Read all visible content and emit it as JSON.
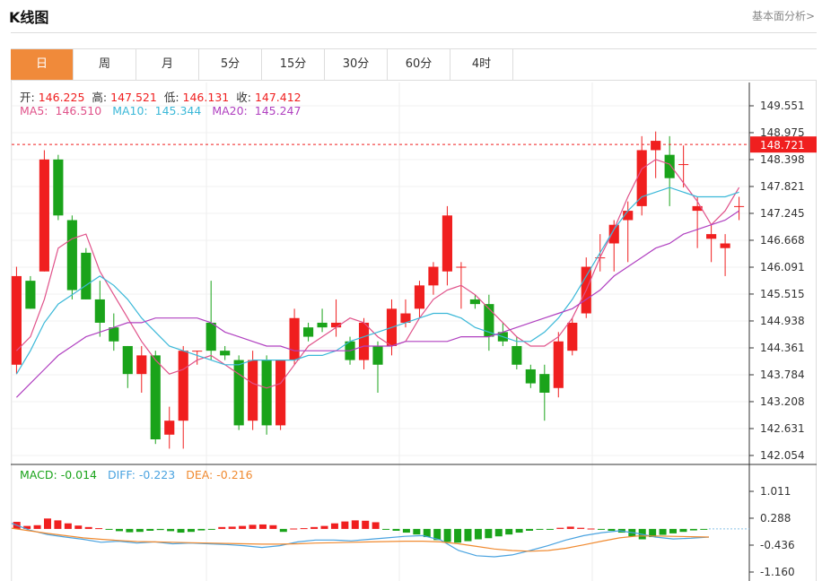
{
  "header": {
    "title": "K线图",
    "link": "基本面分析>"
  },
  "tabs": [
    {
      "label": "日",
      "active": true
    },
    {
      "label": "周"
    },
    {
      "label": "月"
    },
    {
      "label": "5分"
    },
    {
      "label": "15分"
    },
    {
      "label": "30分"
    },
    {
      "label": "60分"
    },
    {
      "label": "4时"
    }
  ],
  "ohlc_legend": {
    "open_label": "开:",
    "open": "146.225",
    "high_label": "高:",
    "high": "147.521",
    "low_label": "低:",
    "low": "146.131",
    "close_label": "收:",
    "close": "147.412"
  },
  "ma_legend": {
    "ma5_label": "MA5:",
    "ma5": "146.510",
    "ma10_label": "MA10:",
    "ma10": "145.344",
    "ma20_label": "MA20:",
    "ma20": "145.247"
  },
  "macd_legend": {
    "macd_label": "MACD:",
    "macd": "-0.014",
    "diff_label": "DIFF:",
    "diff": "-0.223",
    "dea_label": "DEA:",
    "dea": "-0.216"
  },
  "colors": {
    "up": "#f01f1f",
    "down": "#1aa31a",
    "ma5": "#e0528a",
    "ma10": "#3bb8d8",
    "ma20": "#b040c0",
    "diff": "#4aa3e0",
    "dea": "#f08a30",
    "price_tag": "#f01f1f",
    "tab_active": "#f08a3a"
  },
  "chart_data": [
    {
      "type": "candlestick",
      "current_price": "148.721",
      "ylim": [
        142.054,
        149.551
      ],
      "y_ticks": [
        "149.551",
        "148.975",
        "148.398",
        "147.821",
        "147.245",
        "146.668",
        "146.091",
        "145.515",
        "144.938",
        "144.361",
        "143.784",
        "143.208",
        "142.631",
        "142.054"
      ],
      "series": [
        {
          "name": "MA5",
          "values": [
            144.3,
            144.6,
            145.4,
            146.5,
            146.7,
            146.8,
            146.0,
            145.5,
            145.0,
            144.5,
            144.1,
            143.8,
            143.9,
            144.1,
            144.2,
            144.0,
            143.8,
            143.6,
            143.5,
            143.6,
            144.0,
            144.4,
            144.6,
            144.8,
            145.0,
            144.9,
            144.6,
            144.4,
            144.5,
            145.0,
            145.4,
            145.6,
            145.7,
            145.5,
            145.2,
            144.9,
            144.6,
            144.4,
            144.4,
            144.6,
            145.0,
            145.6,
            146.3,
            146.9,
            147.6,
            148.2,
            148.4,
            148.3,
            147.9,
            147.5,
            147.0,
            147.3,
            147.8
          ]
        },
        {
          "name": "MA10",
          "values": [
            143.8,
            144.3,
            144.9,
            145.3,
            145.5,
            145.7,
            145.9,
            145.7,
            145.4,
            145.0,
            144.7,
            144.4,
            144.3,
            144.2,
            144.1,
            144.0,
            144.0,
            144.1,
            144.1,
            144.1,
            144.1,
            144.2,
            144.2,
            144.3,
            144.5,
            144.6,
            144.7,
            144.8,
            144.9,
            145.0,
            145.1,
            145.1,
            145.0,
            144.8,
            144.7,
            144.6,
            144.5,
            144.5,
            144.7,
            145.0,
            145.4,
            145.9,
            146.4,
            146.9,
            147.3,
            147.6,
            147.7,
            147.8,
            147.7,
            147.6,
            147.6,
            147.6,
            147.7
          ]
        },
        {
          "name": "MA20",
          "values": [
            143.3,
            143.6,
            143.9,
            144.2,
            144.4,
            144.6,
            144.7,
            144.8,
            144.9,
            144.9,
            145.0,
            145.0,
            145.0,
            145.0,
            144.9,
            144.7,
            144.6,
            144.5,
            144.4,
            144.4,
            144.3,
            144.3,
            144.3,
            144.3,
            144.3,
            144.4,
            144.4,
            144.4,
            144.5,
            144.5,
            144.5,
            144.5,
            144.6,
            144.6,
            144.6,
            144.7,
            144.8,
            144.9,
            145.0,
            145.1,
            145.2,
            145.4,
            145.6,
            145.9,
            146.1,
            146.3,
            146.5,
            146.6,
            146.8,
            146.9,
            147.0,
            147.1,
            147.3
          ]
        }
      ],
      "candles": [
        [
          144.0,
          145.9,
          143.8,
          146.1
        ],
        [
          145.8,
          145.2,
          145.2,
          145.9
        ],
        [
          146.0,
          148.4,
          146.0,
          148.6
        ],
        [
          148.4,
          147.2,
          147.1,
          148.5
        ],
        [
          147.1,
          145.6,
          145.4,
          147.2
        ],
        [
          146.4,
          145.4,
          145.4,
          146.5
        ],
        [
          145.4,
          144.9,
          144.6,
          145.8
        ],
        [
          144.8,
          144.5,
          144.3,
          145.1
        ],
        [
          144.4,
          143.8,
          143.5,
          144.4
        ],
        [
          143.8,
          144.2,
          143.4,
          144.4
        ],
        [
          144.2,
          142.4,
          142.3,
          144.3
        ],
        [
          142.5,
          142.8,
          142.2,
          143.1
        ],
        [
          142.8,
          144.3,
          142.2,
          144.4
        ],
        [
          144.3,
          144.3,
          144.0,
          144.3
        ],
        [
          144.9,
          144.3,
          144.1,
          145.8
        ],
        [
          144.3,
          144.2,
          144.1,
          144.4
        ],
        [
          144.1,
          142.7,
          142.6,
          144.2
        ],
        [
          142.8,
          144.1,
          142.6,
          144.3
        ],
        [
          144.1,
          142.7,
          142.5,
          144.2
        ],
        [
          142.7,
          144.1,
          142.6,
          144.1
        ],
        [
          144.1,
          145.0,
          144.0,
          145.2
        ],
        [
          144.8,
          144.6,
          144.5,
          144.9
        ],
        [
          144.9,
          144.8,
          144.7,
          145.2
        ],
        [
          144.8,
          144.9,
          144.6,
          145.4
        ],
        [
          144.5,
          144.1,
          144.0,
          144.6
        ],
        [
          144.1,
          144.9,
          143.9,
          145.0
        ],
        [
          144.4,
          144.0,
          143.4,
          144.5
        ],
        [
          144.4,
          145.2,
          144.2,
          145.4
        ],
        [
          144.9,
          145.1,
          144.8,
          145.4
        ],
        [
          145.2,
          145.7,
          145.0,
          145.8
        ],
        [
          145.7,
          146.1,
          145.5,
          146.2
        ],
        [
          146.0,
          147.2,
          145.7,
          147.4
        ],
        [
          146.1,
          146.1,
          145.2,
          146.2
        ],
        [
          145.4,
          145.3,
          145.2,
          145.5
        ],
        [
          145.3,
          144.6,
          144.3,
          145.5
        ],
        [
          144.7,
          144.5,
          144.4,
          144.9
        ],
        [
          144.4,
          144.0,
          143.9,
          144.6
        ],
        [
          143.9,
          143.6,
          143.5,
          144.0
        ],
        [
          143.8,
          143.4,
          142.8,
          144.0
        ],
        [
          143.5,
          144.5,
          143.3,
          144.7
        ],
        [
          144.3,
          144.9,
          144.2,
          145.0
        ],
        [
          145.1,
          146.1,
          145.0,
          146.3
        ],
        [
          146.3,
          146.3,
          146.0,
          146.8
        ],
        [
          146.6,
          147.0,
          146.0,
          147.1
        ],
        [
          147.1,
          147.3,
          146.2,
          147.5
        ],
        [
          147.4,
          148.6,
          147.2,
          148.9
        ],
        [
          148.6,
          148.8,
          148.0,
          149.0
        ],
        [
          148.5,
          148.0,
          147.4,
          148.9
        ],
        [
          148.3,
          148.3,
          147.8,
          148.7
        ],
        [
          147.3,
          147.4,
          146.5,
          147.6
        ],
        [
          146.7,
          146.8,
          146.2,
          147.0
        ],
        [
          146.5,
          146.6,
          145.9,
          146.8
        ],
        [
          147.4,
          147.4,
          147.1,
          147.6
        ]
      ]
    },
    {
      "type": "bar",
      "title": "MACD",
      "ylim": [
        -1.16,
        1.011
      ],
      "y_ticks": [
        "1.011",
        "0.288",
        "-0.436",
        "-1.160"
      ],
      "values": [
        0.19,
        0.08,
        0.1,
        0.28,
        0.23,
        0.15,
        0.09,
        0.05,
        0.02,
        -0.01,
        -0.06,
        -0.09,
        -0.08,
        -0.05,
        -0.03,
        -0.06,
        -0.1,
        -0.08,
        -0.04,
        -0.02,
        0.05,
        0.06,
        0.08,
        0.11,
        0.12,
        0.1,
        -0.08,
        0.01,
        0.02,
        0.05,
        0.08,
        0.15,
        0.2,
        0.23,
        0.22,
        0.18,
        -0.02,
        -0.05,
        -0.1,
        -0.15,
        -0.22,
        -0.3,
        -0.35,
        -0.37,
        -0.33,
        -0.28,
        -0.25,
        -0.2,
        -0.15,
        -0.1,
        -0.05,
        -0.02,
        -0.01,
        0.03,
        0.06,
        0.03,
        0.01,
        -0.02,
        -0.05,
        -0.1,
        -0.2,
        -0.28,
        -0.22,
        -0.16,
        -0.12,
        -0.08,
        -0.04,
        -0.01
      ],
      "series": [
        {
          "name": "DIFF",
          "values": [
            0.15,
            -0.03,
            -0.15,
            -0.22,
            -0.28,
            -0.36,
            -0.33,
            -0.38,
            -0.35,
            -0.4,
            -0.38,
            -0.4,
            -0.42,
            -0.45,
            -0.5,
            -0.45,
            -0.35,
            -0.3,
            -0.3,
            -0.32,
            -0.28,
            -0.24,
            -0.2,
            -0.18,
            -0.3,
            -0.58,
            -0.72,
            -0.75,
            -0.7,
            -0.58,
            -0.45,
            -0.3,
            -0.18,
            -0.1,
            -0.05,
            -0.12,
            -0.22,
            -0.27,
            -0.25,
            -0.22
          ]
        },
        {
          "name": "DEA",
          "values": [
            0.02,
            -0.05,
            -0.12,
            -0.18,
            -0.24,
            -0.28,
            -0.31,
            -0.34,
            -0.35,
            -0.36,
            -0.37,
            -0.38,
            -0.39,
            -0.4,
            -0.41,
            -0.41,
            -0.4,
            -0.38,
            -0.37,
            -0.36,
            -0.35,
            -0.34,
            -0.33,
            -0.33,
            -0.35,
            -0.4,
            -0.47,
            -0.54,
            -0.58,
            -0.6,
            -0.58,
            -0.52,
            -0.43,
            -0.33,
            -0.24,
            -0.19,
            -0.19,
            -0.2,
            -0.21,
            -0.22
          ]
        }
      ]
    }
  ]
}
